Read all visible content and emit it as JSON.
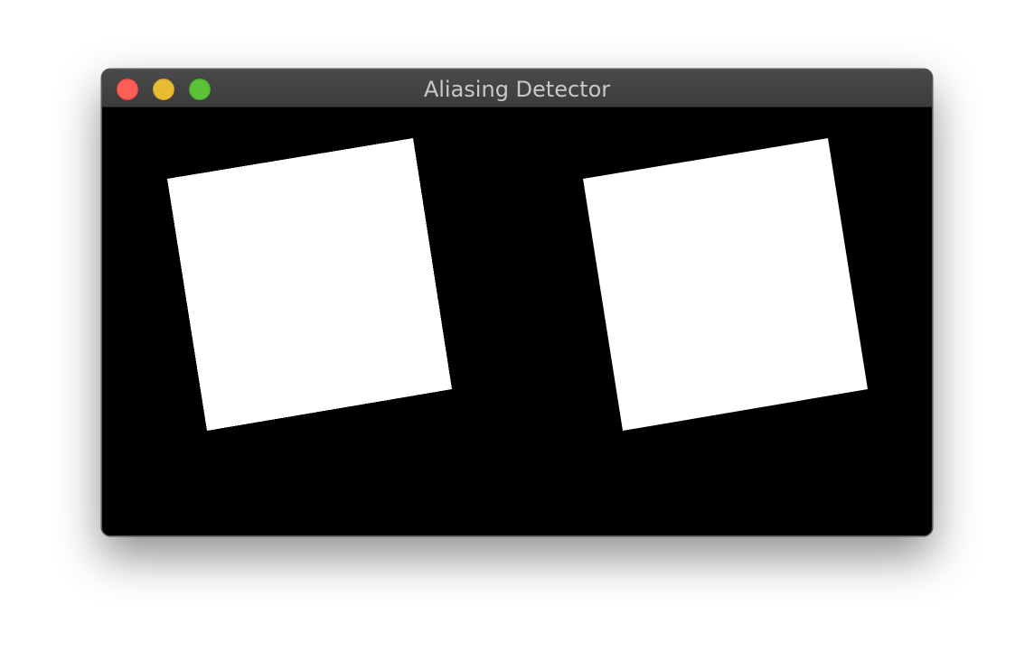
{
  "window": {
    "title": "Aliasing Detector"
  },
  "canvas": {
    "background_color": "#000000",
    "shape_color": "#ffffff",
    "shapes": [
      {
        "name": "aliased-square",
        "type": "rotated-square"
      },
      {
        "name": "antialiased-square",
        "type": "rotated-square"
      }
    ]
  }
}
